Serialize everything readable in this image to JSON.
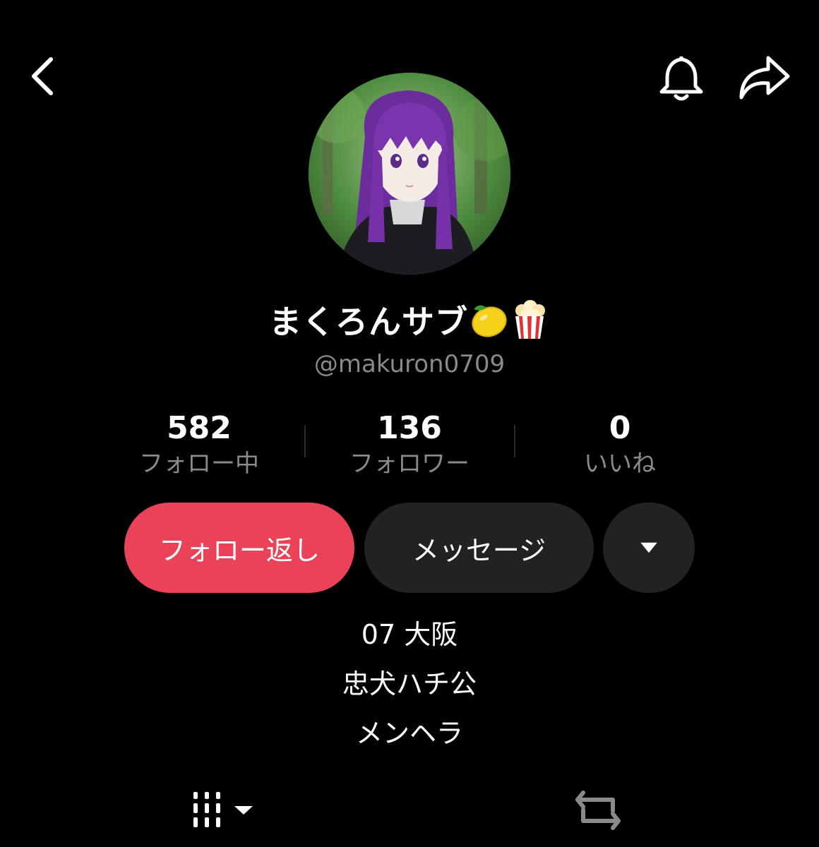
{
  "profile": {
    "display_name": "まくろんサブ",
    "name_emojis": [
      "lemon-emoji",
      "popcorn-emoji"
    ],
    "username": "@makuron0709"
  },
  "stats": [
    {
      "value": "582",
      "label": "フォロー中"
    },
    {
      "value": "136",
      "label": "フォロワー"
    },
    {
      "value": "0",
      "label": "いいね"
    }
  ],
  "actions": {
    "follow_back": "フォロー返し",
    "message": "メッセージ"
  },
  "bio": [
    "07 大阪",
    "忠犬ハチ公",
    "メンヘラ"
  ],
  "icons": {
    "back": "chevron-left-icon",
    "bell": "bell-icon",
    "share": "share-arrow-icon",
    "more": "caret-down-icon",
    "grid_tab": "grid-icon",
    "repost_tab": "repost-icon"
  },
  "colors": {
    "accent": "#ea4359",
    "background": "#000000",
    "secondary_text": "#8a8a8a",
    "button_dark": "#222222"
  }
}
